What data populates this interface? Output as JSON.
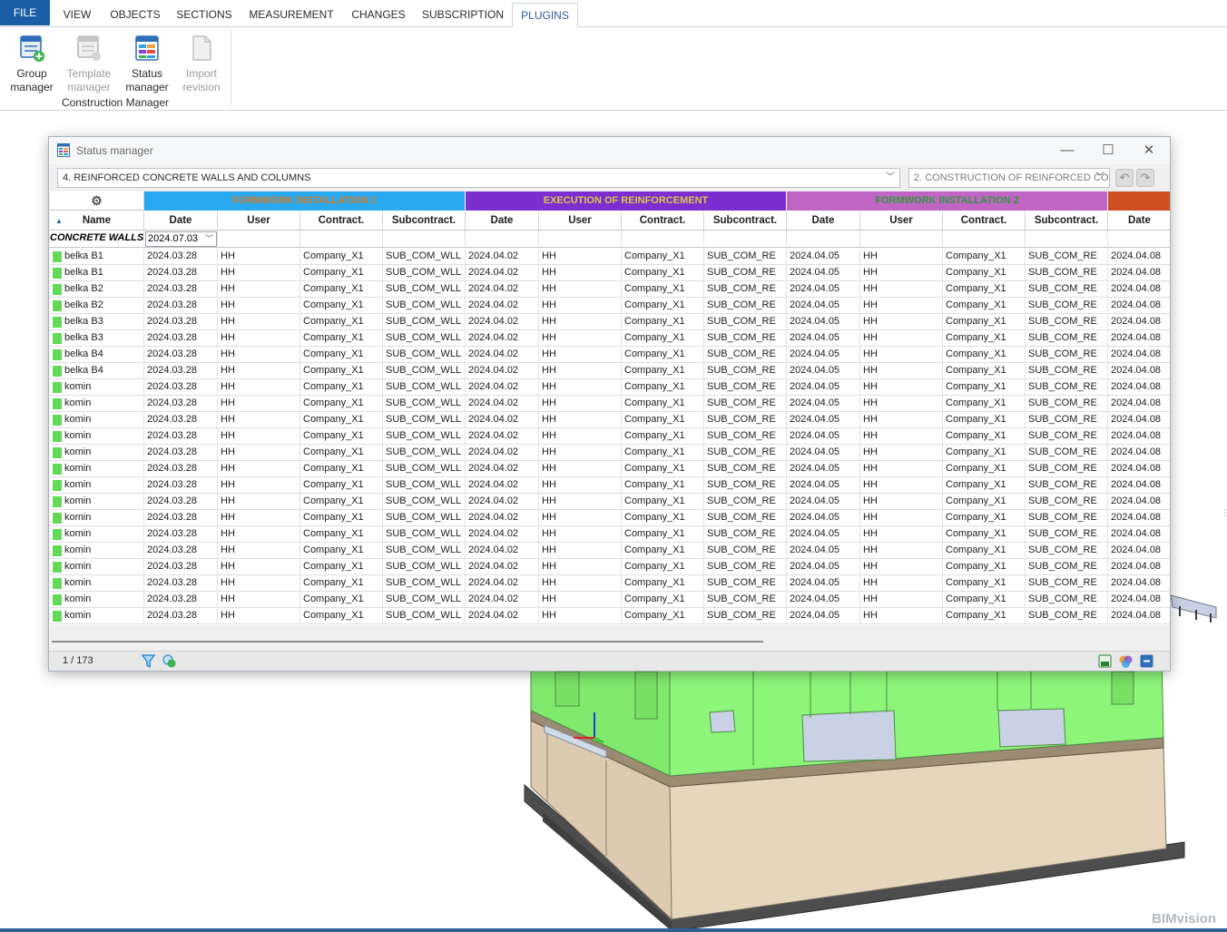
{
  "ribbon": {
    "tabs": [
      {
        "label": "FILE"
      },
      {
        "label": "VIEW"
      },
      {
        "label": "OBJECTS"
      },
      {
        "label": "SECTIONS"
      },
      {
        "label": "MEASUREMENT"
      },
      {
        "label": "CHANGES"
      },
      {
        "label": "SUBSCRIPTION"
      },
      {
        "label": "PLUGINS"
      }
    ],
    "active_tab": "PLUGINS",
    "buttons": [
      {
        "line1": "Group",
        "line2": "manager",
        "enabled": true,
        "icon": "group-manager-icon"
      },
      {
        "line1": "Template",
        "line2": "manager",
        "enabled": false,
        "icon": "template-manager-icon"
      },
      {
        "line1": "Status",
        "line2": "manager",
        "enabled": true,
        "icon": "status-manager-icon"
      },
      {
        "line1": "Import",
        "line2": "revision",
        "enabled": false,
        "icon": "import-revision-icon"
      }
    ],
    "group_caption": "Construction Manager"
  },
  "window": {
    "title": "Status manager",
    "controls": {
      "minimize": "—",
      "maximize": "☐",
      "close": "✕"
    },
    "stage_select": "4. REINFORCED CONCRETE WALLS AND COLUMNS",
    "phase_select": "2. CONSTRUCTION OF REINFORCED CO",
    "group_headers": [
      {
        "label": "FORMWORK INSTALLATION 1",
        "bg": "#29a9ef",
        "fg": "#d97a1f"
      },
      {
        "label": "EXECUTION OF REINFORCEMENT",
        "bg": "#7b2fd1",
        "fg": "#d9c64a"
      },
      {
        "label": "FORMWORK INSTALLATION 2",
        "bg": "#c065c4",
        "fg": "#2f9a3d"
      },
      {
        "label": "",
        "bg": "#cf4e22",
        "fg": "#ffffff"
      }
    ],
    "columns": [
      "Name",
      "Date",
      "User",
      "Contract.",
      "Subcontract.",
      "Date",
      "User",
      "Contract.",
      "Subcontract.",
      "Date",
      "User",
      "Contract.",
      "Subcontract.",
      "Date"
    ],
    "filter": {
      "name": "CONCRETE WALLS A",
      "date": "2024.07.03"
    },
    "rows": [
      [
        "belka B1",
        "2024.03.28",
        "HH",
        "Company_X1",
        "SUB_COM_WLL",
        "2024.04.02",
        "HH",
        "Company_X1",
        "SUB_COM_RE",
        "2024.04.05",
        "HH",
        "Company_X1",
        "SUB_COM_RE",
        "2024.04.08"
      ],
      [
        "belka B1",
        "2024.03.28",
        "HH",
        "Company_X1",
        "SUB_COM_WLL",
        "2024.04.02",
        "HH",
        "Company_X1",
        "SUB_COM_RE",
        "2024.04.05",
        "HH",
        "Company_X1",
        "SUB_COM_RE",
        "2024.04.08"
      ],
      [
        "belka B2",
        "2024.03.28",
        "HH",
        "Company_X1",
        "SUB_COM_WLL",
        "2024.04.02",
        "HH",
        "Company_X1",
        "SUB_COM_RE",
        "2024.04.05",
        "HH",
        "Company_X1",
        "SUB_COM_RE",
        "2024.04.08"
      ],
      [
        "belka B2",
        "2024.03.28",
        "HH",
        "Company_X1",
        "SUB_COM_WLL",
        "2024.04.02",
        "HH",
        "Company_X1",
        "SUB_COM_RE",
        "2024.04.05",
        "HH",
        "Company_X1",
        "SUB_COM_RE",
        "2024.04.08"
      ],
      [
        "belka B3",
        "2024.03.28",
        "HH",
        "Company_X1",
        "SUB_COM_WLL",
        "2024.04.02",
        "HH",
        "Company_X1",
        "SUB_COM_RE",
        "2024.04.05",
        "HH",
        "Company_X1",
        "SUB_COM_RE",
        "2024.04.08"
      ],
      [
        "belka B3",
        "2024.03.28",
        "HH",
        "Company_X1",
        "SUB_COM_WLL",
        "2024.04.02",
        "HH",
        "Company_X1",
        "SUB_COM_RE",
        "2024.04.05",
        "HH",
        "Company_X1",
        "SUB_COM_RE",
        "2024.04.08"
      ],
      [
        "belka B4",
        "2024.03.28",
        "HH",
        "Company_X1",
        "SUB_COM_WLL",
        "2024.04.02",
        "HH",
        "Company_X1",
        "SUB_COM_RE",
        "2024.04.05",
        "HH",
        "Company_X1",
        "SUB_COM_RE",
        "2024.04.08"
      ],
      [
        "belka B4",
        "2024.03.28",
        "HH",
        "Company_X1",
        "SUB_COM_WLL",
        "2024.04.02",
        "HH",
        "Company_X1",
        "SUB_COM_RE",
        "2024.04.05",
        "HH",
        "Company_X1",
        "SUB_COM_RE",
        "2024.04.08"
      ],
      [
        "komin",
        "2024.03.28",
        "HH",
        "Company_X1",
        "SUB_COM_WLL",
        "2024.04.02",
        "HH",
        "Company_X1",
        "SUB_COM_RE",
        "2024.04.05",
        "HH",
        "Company_X1",
        "SUB_COM_RE",
        "2024.04.08"
      ],
      [
        "komin",
        "2024.03.28",
        "HH",
        "Company_X1",
        "SUB_COM_WLL",
        "2024.04.02",
        "HH",
        "Company_X1",
        "SUB_COM_RE",
        "2024.04.05",
        "HH",
        "Company_X1",
        "SUB_COM_RE",
        "2024.04.08"
      ],
      [
        "komin",
        "2024.03.28",
        "HH",
        "Company_X1",
        "SUB_COM_WLL",
        "2024.04.02",
        "HH",
        "Company_X1",
        "SUB_COM_RE",
        "2024.04.05",
        "HH",
        "Company_X1",
        "SUB_COM_RE",
        "2024.04.08"
      ],
      [
        "komin",
        "2024.03.28",
        "HH",
        "Company_X1",
        "SUB_COM_WLL",
        "2024.04.02",
        "HH",
        "Company_X1",
        "SUB_COM_RE",
        "2024.04.05",
        "HH",
        "Company_X1",
        "SUB_COM_RE",
        "2024.04.08"
      ],
      [
        "komin",
        "2024.03.28",
        "HH",
        "Company_X1",
        "SUB_COM_WLL",
        "2024.04.02",
        "HH",
        "Company_X1",
        "SUB_COM_RE",
        "2024.04.05",
        "HH",
        "Company_X1",
        "SUB_COM_RE",
        "2024.04.08"
      ],
      [
        "komin",
        "2024.03.28",
        "HH",
        "Company_X1",
        "SUB_COM_WLL",
        "2024.04.02",
        "HH",
        "Company_X1",
        "SUB_COM_RE",
        "2024.04.05",
        "HH",
        "Company_X1",
        "SUB_COM_RE",
        "2024.04.08"
      ],
      [
        "komin",
        "2024.03.28",
        "HH",
        "Company_X1",
        "SUB_COM_WLL",
        "2024.04.02",
        "HH",
        "Company_X1",
        "SUB_COM_RE",
        "2024.04.05",
        "HH",
        "Company_X1",
        "SUB_COM_RE",
        "2024.04.08"
      ],
      [
        "komin",
        "2024.03.28",
        "HH",
        "Company_X1",
        "SUB_COM_WLL",
        "2024.04.02",
        "HH",
        "Company_X1",
        "SUB_COM_RE",
        "2024.04.05",
        "HH",
        "Company_X1",
        "SUB_COM_RE",
        "2024.04.08"
      ],
      [
        "komin",
        "2024.03.28",
        "HH",
        "Company_X1",
        "SUB_COM_WLL",
        "2024.04.02",
        "HH",
        "Company_X1",
        "SUB_COM_RE",
        "2024.04.05",
        "HH",
        "Company_X1",
        "SUB_COM_RE",
        "2024.04.08"
      ],
      [
        "komin",
        "2024.03.28",
        "HH",
        "Company_X1",
        "SUB_COM_WLL",
        "2024.04.02",
        "HH",
        "Company_X1",
        "SUB_COM_RE",
        "2024.04.05",
        "HH",
        "Company_X1",
        "SUB_COM_RE",
        "2024.04.08"
      ],
      [
        "komin",
        "2024.03.28",
        "HH",
        "Company_X1",
        "SUB_COM_WLL",
        "2024.04.02",
        "HH",
        "Company_X1",
        "SUB_COM_RE",
        "2024.04.05",
        "HH",
        "Company_X1",
        "SUB_COM_RE",
        "2024.04.08"
      ],
      [
        "komin",
        "2024.03.28",
        "HH",
        "Company_X1",
        "SUB_COM_WLL",
        "2024.04.02",
        "HH",
        "Company_X1",
        "SUB_COM_RE",
        "2024.04.05",
        "HH",
        "Company_X1",
        "SUB_COM_RE",
        "2024.04.08"
      ],
      [
        "komin",
        "2024.03.28",
        "HH",
        "Company_X1",
        "SUB_COM_WLL",
        "2024.04.02",
        "HH",
        "Company_X1",
        "SUB_COM_RE",
        "2024.04.05",
        "HH",
        "Company_X1",
        "SUB_COM_RE",
        "2024.04.08"
      ],
      [
        "komin",
        "2024.03.28",
        "HH",
        "Company_X1",
        "SUB_COM_WLL",
        "2024.04.02",
        "HH",
        "Company_X1",
        "SUB_COM_RE",
        "2024.04.05",
        "HH",
        "Company_X1",
        "SUB_COM_RE",
        "2024.04.08"
      ],
      [
        "komin",
        "2024.03.28",
        "HH",
        "Company_X1",
        "SUB_COM_WLL",
        "2024.04.02",
        "HH",
        "Company_X1",
        "SUB_COM_RE",
        "2024.04.05",
        "HH",
        "Company_X1",
        "SUB_COM_RE",
        "2024.04.08"
      ]
    ],
    "status_color": "#63d957",
    "record_count": "1 / 173"
  },
  "viewport": {
    "watermark": "BIMvision",
    "model_colors": {
      "completed": "#8cf57a",
      "wall": "#e6d6be",
      "slab": "#9b8b73",
      "footing": "#5a5a5a"
    }
  }
}
